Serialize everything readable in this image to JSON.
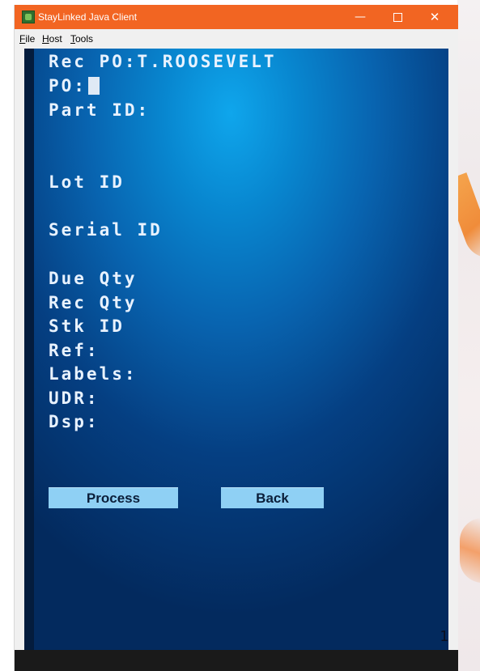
{
  "window": {
    "title": "StayLinked Java Client",
    "controls": {
      "minimize": "—",
      "close": "✕"
    }
  },
  "menu": [
    {
      "accel": "F",
      "rest": "ile"
    },
    {
      "accel": "H",
      "rest": "ost"
    },
    {
      "accel": "T",
      "rest": "ools"
    }
  ],
  "screen": {
    "title": "Rec PO:T.ROOSEVELT",
    "po_label": "PO:",
    "fields": {
      "part_id": "Part ID:",
      "lot_id": "Lot ID",
      "serial_id": "Serial ID",
      "due_qty": "Due Qty",
      "rec_qty": "Rec Qty",
      "stk_id": "Stk ID",
      "ref": "Ref:",
      "labels": "Labels:",
      "udr": "UDR:",
      "dsp": "Dsp:"
    },
    "buttons": {
      "process": "Process",
      "back": "Back"
    },
    "page_number": "1"
  },
  "colors": {
    "title_bar": "#f26522",
    "terminal_center": "#0fa6ec",
    "terminal_edge": "#032a5e",
    "button_bg": "#8fd0f4"
  },
  "icons": {
    "app": "staylinked-app-icon",
    "minimize": "minimize-icon",
    "maximize": "maximize-icon",
    "close": "close-icon"
  }
}
